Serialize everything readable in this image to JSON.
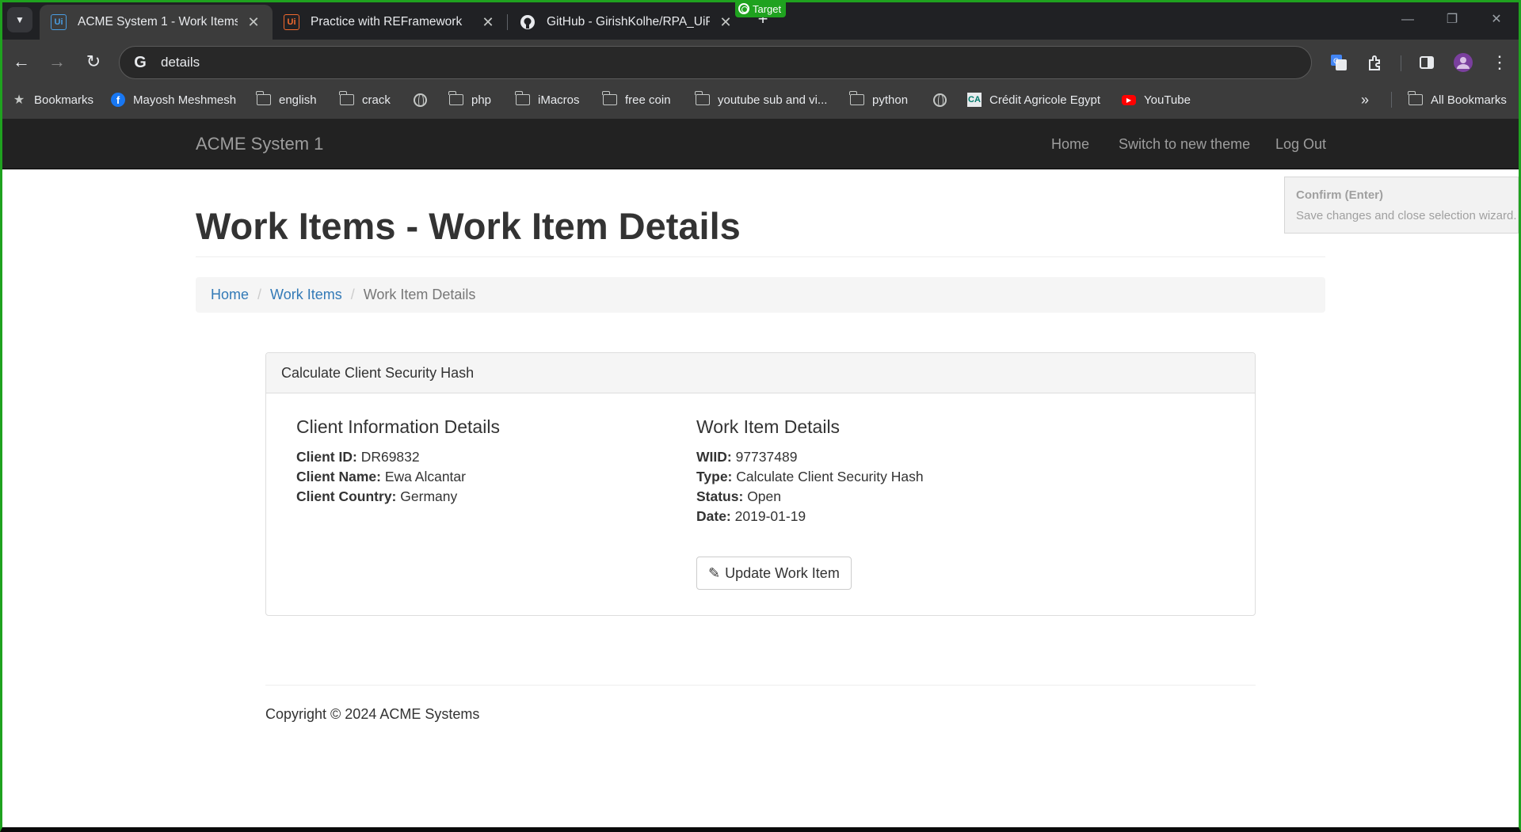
{
  "browser": {
    "tabs": [
      {
        "title": "ACME System 1 - Work Items",
        "favicon": "Ui"
      },
      {
        "title": "Practice with REFramework",
        "favicon": "Ui"
      },
      {
        "title": "GitHub - GirishKolhe/RPA_UiPat",
        "favicon": "github-icon"
      }
    ],
    "target_badge": "Target",
    "address": "details",
    "bookmarks": [
      {
        "label": "Bookmarks",
        "icon": "star-icon"
      },
      {
        "label": "Mayosh Meshmesh",
        "icon": "facebook-icon"
      },
      {
        "label": "english",
        "icon": "folder-icon"
      },
      {
        "label": "crack",
        "icon": "folder-icon"
      },
      {
        "label": "",
        "icon": "globe-icon"
      },
      {
        "label": "php",
        "icon": "folder-icon"
      },
      {
        "label": "iMacros",
        "icon": "folder-icon"
      },
      {
        "label": "free coin",
        "icon": "folder-icon"
      },
      {
        "label": "youtube sub and vi...",
        "icon": "folder-icon"
      },
      {
        "label": "python",
        "icon": "folder-icon"
      },
      {
        "label": "",
        "icon": "globe-icon"
      },
      {
        "label": "Crédit Agricole Egypt",
        "icon": "credit-agricole-icon"
      },
      {
        "label": "YouTube",
        "icon": "youtube-icon"
      }
    ],
    "all_bookmarks": "All Bookmarks",
    "colors": {
      "frame": "#1fa21f",
      "tab_bar": "#202124",
      "toolbar": "#3c3c3c"
    }
  },
  "navbar": {
    "brand": "ACME System 1",
    "links": [
      "Home",
      "Switch to new theme",
      "Log Out"
    ]
  },
  "page": {
    "title": "Work Items - Work Item Details",
    "breadcrumb": {
      "home": "Home",
      "work_items": "Work Items",
      "current": "Work Item Details"
    },
    "panel": {
      "heading": "Calculate Client Security Hash",
      "client": {
        "heading": "Client Information Details",
        "id_label": "Client ID:",
        "id": "DR69832",
        "name_label": "Client Name:",
        "name": "Ewa Alcantar",
        "country_label": "Client Country:",
        "country": "Germany"
      },
      "work_item": {
        "heading": "Work Item Details",
        "wiid_label": "WIID:",
        "wiid": "97737489",
        "type_label": "Type:",
        "type": "Calculate Client Security Hash",
        "status_label": "Status:",
        "status": "Open",
        "date_label": "Date:",
        "date": "2019-01-19"
      },
      "update_button": "Update Work Item"
    },
    "footer": "Copyright © 2024 ACME Systems"
  },
  "confirm_tooltip": {
    "title": "Confirm (Enter)",
    "text": "Save changes and close selection wizard."
  }
}
